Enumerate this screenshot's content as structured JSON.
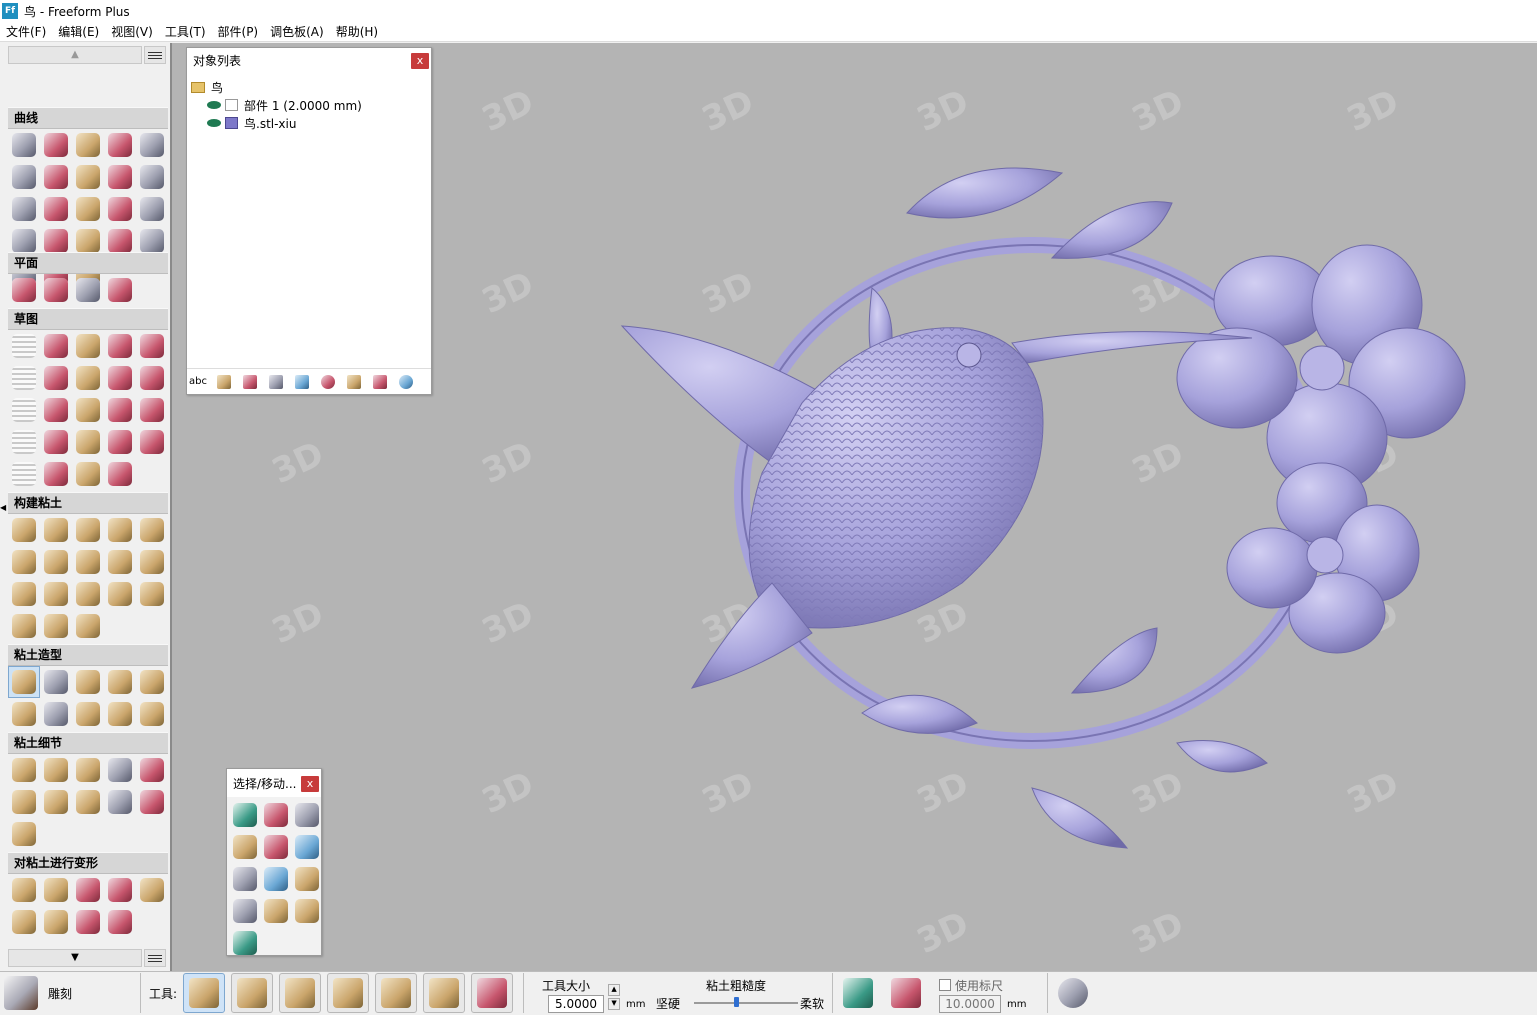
{
  "window": {
    "title": "鸟 - Freeform Plus",
    "logo_text": "Ff"
  },
  "menu": [
    "文件(F)",
    "编辑(E)",
    "视图(V)",
    "工具(T)",
    "部件(P)",
    "调色板(A)",
    "帮助(H)"
  ],
  "left_panel": {
    "sections": [
      {
        "title": "曲线",
        "tools": [
          "select-arrow",
          "curve-pen",
          "surface",
          "sphere-surface",
          "cube-wire",
          "ring",
          "arc-tool",
          "bend",
          "curve-edit",
          "curve-extend",
          "curve-line",
          "patch",
          "mirror-curve",
          "blend",
          "pipe",
          "ring-flat",
          "spiral-curve",
          "knot",
          "spring",
          "stripes",
          "fan",
          "wave",
          "swoosh"
        ]
      },
      {
        "title": "平面",
        "tools": [
          "plane-grid",
          "plane-edit",
          "plane-cut",
          "plane-move"
        ]
      },
      {
        "title": "草图",
        "tools": [
          "sketch-trace",
          "sketch-image",
          "sketch-pencil",
          "sketch-spline",
          "sketch-polyline",
          "sketch-curve",
          "sketch-line",
          "sketch-arc",
          "sketch-corner",
          "sketch-circle",
          "sketch-ellipse",
          "sketch-star",
          "sketch-hexagon",
          "sketch-rectangle",
          "sketch-text",
          "sketch-trim",
          "sketch-mirror",
          "sketch-offset",
          "sketch-dimension",
          "sketch-pattern",
          "sketch-checker",
          "sketch-fill",
          "sketch-dots",
          "sketch-export"
        ]
      },
      {
        "title": "构建粘土",
        "tools": [
          "clay-stamp",
          "clay-rail",
          "clay-loft",
          "clay-extrude",
          "clay-block",
          "clay-sphere",
          "clay-wrap",
          "clay-sweep",
          "clay-revolve",
          "clay-pipe",
          "clay-wave",
          "clay-emboss",
          "clay-face",
          "clay-spray",
          "clay-bend",
          "clay-thin",
          "clay-disc",
          "clay-ring"
        ]
      },
      {
        "title": "粘土造型",
        "tools": [
          "carve",
          "smudge",
          "raise",
          "flatten",
          "press",
          "smooth-ball",
          "spot",
          "orange-ball",
          "ring-tool",
          "bump"
        ]
      },
      {
        "title": "粘土细节",
        "tools": [
          "detail-flat",
          "detail-emboss",
          "detail-pinch",
          "detail-groove",
          "detail-frame",
          "detail-figure",
          "detail-texture",
          "detail-sphere",
          "detail-curl",
          "detail-lattice",
          "detail-badge"
        ]
      },
      {
        "title": "对粘土进行变形",
        "tools": [
          "deform-flat",
          "deform-wave",
          "deform-twist",
          "deform-cage",
          "deform-box",
          "deform-smooth",
          "deform-face",
          "deform-dots",
          "deform-shell"
        ]
      }
    ]
  },
  "object_list": {
    "title": "对象列表",
    "close_label": "x",
    "items": [
      {
        "label": "鸟",
        "type": "folder"
      },
      {
        "label": "部件 1 (2.0000 mm)",
        "type": "piece"
      },
      {
        "label": "鸟.stl-xiu",
        "type": "mesh"
      }
    ],
    "toolbar": {
      "text_button": "abc"
    }
  },
  "select_palette": {
    "title": "选择/移动...",
    "close_label": "x",
    "tools": [
      "select-figure",
      "select-red-figure",
      "select-block",
      "pose-figure",
      "box-select",
      "axes-move",
      "scale-move",
      "xyz-move",
      "cube-move",
      "multi-move",
      "paint-move",
      "box-move",
      "cylinder"
    ]
  },
  "statusbar": {
    "current_tool": "雕刻",
    "tool_label": "工具:",
    "tool_size_label": "工具大小",
    "tool_size_value": "5.0000",
    "tool_size_unit": "mm",
    "roughness_label": "粘土粗糙度",
    "hard_label": "坚硬",
    "soft_label": "柔软",
    "roughness_level": 0.4,
    "use_ruler_label": "使用标尺",
    "ruler_value": "10.0000",
    "ruler_unit": "mm",
    "left_arrow": "◀",
    "up_arrow": "▲",
    "down_arrow": "▼"
  },
  "viewport": {
    "background": "#b4b4b4",
    "model_color": "#a6a2db"
  }
}
